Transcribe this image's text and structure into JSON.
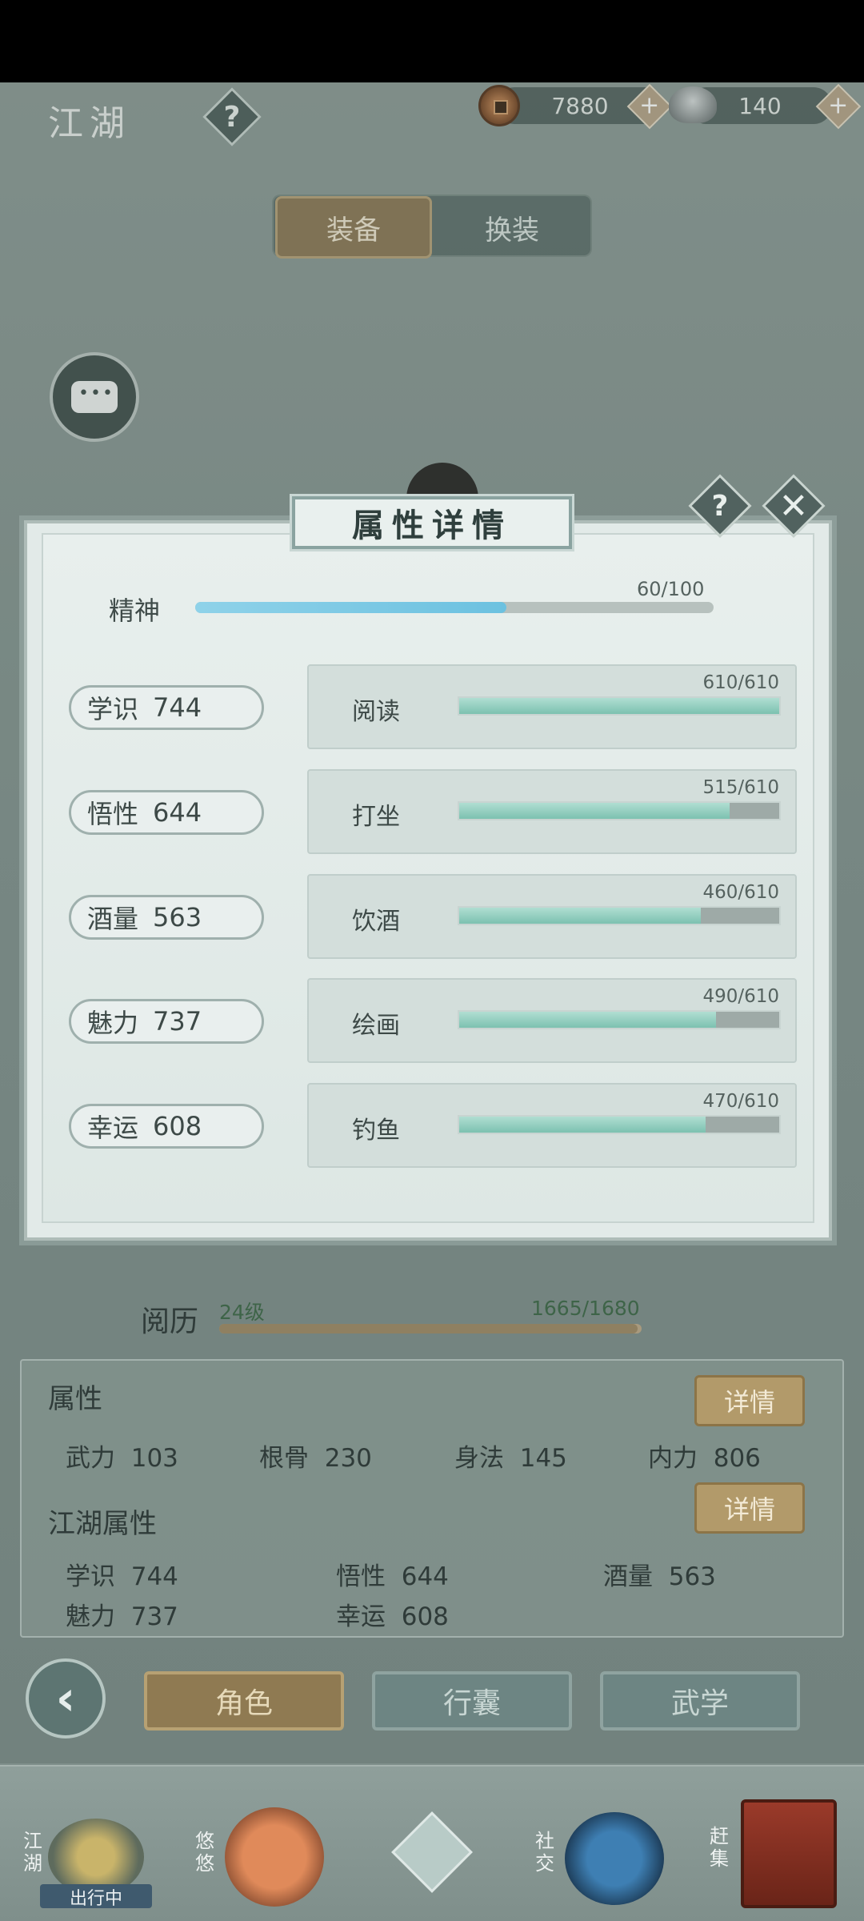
{
  "header": {
    "title": "江湖",
    "help_icon": "?",
    "coins": "7880",
    "silver": "140",
    "plus": "+"
  },
  "tabs": {
    "equip": "装备",
    "outfit": "换装"
  },
  "modal": {
    "title": "属性详情",
    "help": "?",
    "close": "✕",
    "spirit": {
      "label": "精神",
      "value": "60/100",
      "fraction": 0.6
    },
    "rows": [
      {
        "stat_name": "学识",
        "stat_value": "744",
        "activity": "阅读",
        "progress": "610/610",
        "fraction": 1.0
      },
      {
        "stat_name": "悟性",
        "stat_value": "644",
        "activity": "打坐",
        "progress": "515/610",
        "fraction": 0.844
      },
      {
        "stat_name": "酒量",
        "stat_value": "563",
        "activity": "饮酒",
        "progress": "460/610",
        "fraction": 0.754
      },
      {
        "stat_name": "魅力",
        "stat_value": "737",
        "activity": "绘画",
        "progress": "490/610",
        "fraction": 0.803
      },
      {
        "stat_name": "幸运",
        "stat_value": "608",
        "activity": "钓鱼",
        "progress": "470/610",
        "fraction": 0.77
      }
    ]
  },
  "experience": {
    "label": "阅历",
    "level": "24级",
    "value": "1665/1680",
    "fraction": 0.991
  },
  "attributes": {
    "title": "属性",
    "detail": "详情",
    "items": [
      {
        "name": "武力",
        "value": "103"
      },
      {
        "name": "根骨",
        "value": "230"
      },
      {
        "name": "身法",
        "value": "145"
      },
      {
        "name": "内力",
        "value": "806"
      }
    ]
  },
  "jianghu_attributes": {
    "title": "江湖属性",
    "detail": "详情",
    "items": [
      {
        "name": "学识",
        "value": "744"
      },
      {
        "name": "悟性",
        "value": "644"
      },
      {
        "name": "酒量",
        "value": "563"
      },
      {
        "name": "魅力",
        "value": "737"
      },
      {
        "name": "幸运",
        "value": "608"
      }
    ]
  },
  "bottom_tabs": {
    "back": "‹",
    "role": "角色",
    "bag": "行囊",
    "martial": "武学"
  },
  "nav": {
    "jianghu": "江湖",
    "traveling": "出行中",
    "youyou": "悠悠",
    "social": "社交",
    "market": "赶集"
  }
}
